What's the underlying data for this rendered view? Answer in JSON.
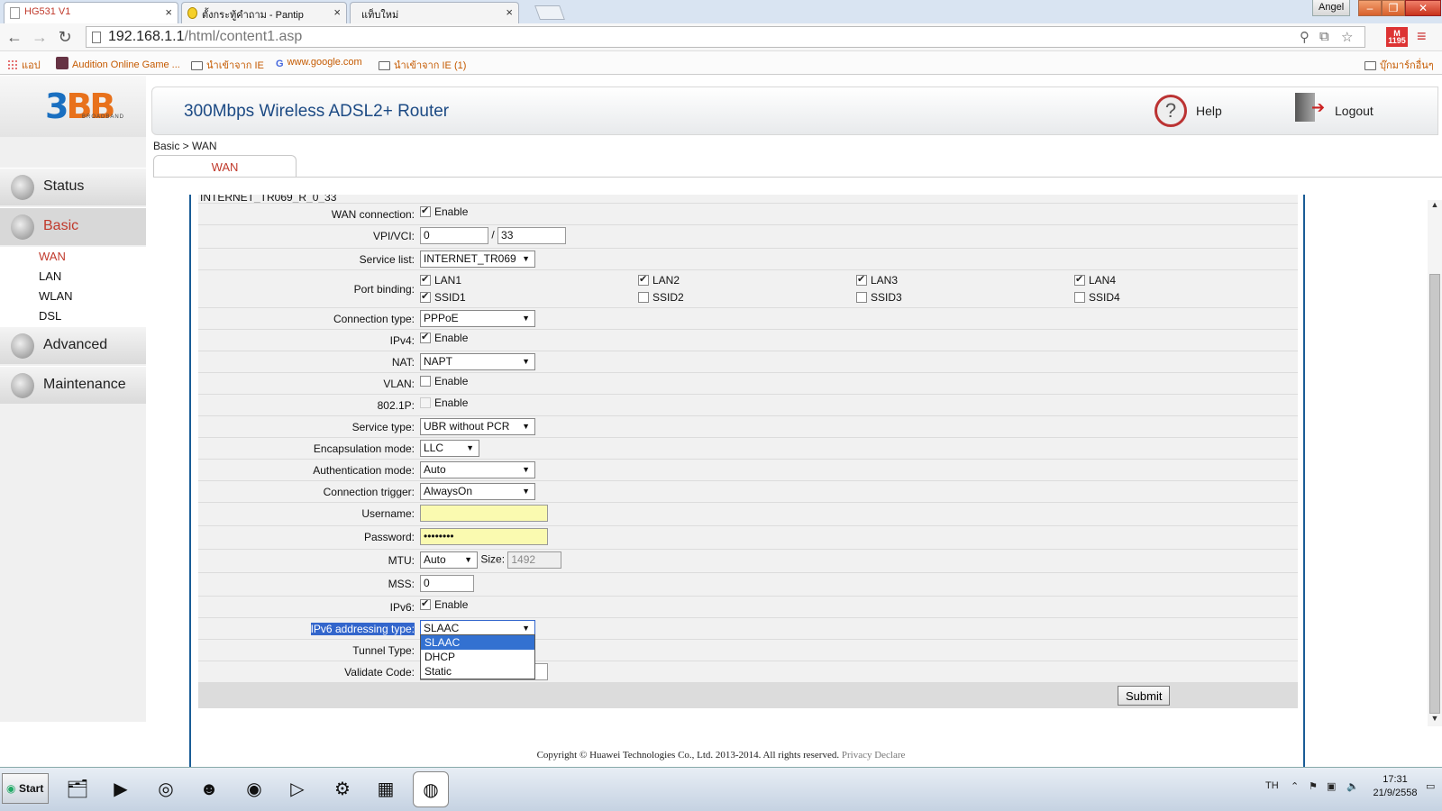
{
  "browser": {
    "tabs": [
      {
        "title": "HG531 V1",
        "active": true
      },
      {
        "title": "ตั้งกระทู้คำถาม - Pantip",
        "active": false
      },
      {
        "title": "แท็บใหม่",
        "active": false
      }
    ],
    "tab_close": "×",
    "profile_name": "Angel",
    "window_buttons": {
      "minimize": "–",
      "maximize": "❐",
      "close": "✕"
    },
    "url_host": "192.168.1.1",
    "url_path": "/html/content1.asp",
    "nav": {
      "back": "←",
      "forward": "→",
      "reload": "↻"
    },
    "gmail_badge": "1195",
    "gmail_letter": "M",
    "menu_icon": "≡",
    "bookmarks": [
      "แอป",
      "Audition Online Game ...",
      "นำเข้าจาก IE",
      "www.google.com",
      "นำเข้าจาก IE (1)"
    ],
    "bookmarks_right": "บุ๊กมาร์กอื่นๆ"
  },
  "router": {
    "title": "300Mbps Wireless ADSL2+ Router",
    "logo_main": "3",
    "logo_bb": "BB",
    "logo_sub": "BROADBAND",
    "help": "Help",
    "logout": "Logout",
    "help_glyph": "?",
    "logout_glyph": "➔",
    "breadcrumb": "Basic > WAN",
    "active_tab": "WAN",
    "nav": {
      "status": "Status",
      "basic": "Basic",
      "basic_sub": [
        "WAN",
        "LAN",
        "WLAN",
        "DSL"
      ],
      "advanced": "Advanced",
      "maintenance": "Maintenance"
    }
  },
  "form": {
    "connection_name": "INTERNET_TR069_R_0_33",
    "enable": "Enable",
    "labels": {
      "wan_connection": "WAN connection:",
      "vpi_vci": "VPI/VCI:",
      "service_list": "Service list:",
      "port_binding": "Port binding:",
      "connection_type": "Connection type:",
      "ipv4": "IPv4:",
      "nat": "NAT:",
      "vlan": "VLAN:",
      "p8021": "802.1P:",
      "service_type": "Service type:",
      "encapsulation": "Encapsulation mode:",
      "auth_mode": "Authentication mode:",
      "conn_trigger": "Connection trigger:",
      "username": "Username:",
      "password": "Password:",
      "mtu": "MTU:",
      "size": "Size:",
      "mss": "MSS:",
      "ipv6": "IPv6:",
      "ipv6_addressing": "IPv6 addressing type:",
      "tunnel_type": "Tunnel Type:",
      "validate_code": "Validate Code:"
    },
    "vpi": "0",
    "vci_sep": "/",
    "vci": "33",
    "service_list": "INTERNET_TR069",
    "ports": [
      {
        "name": "LAN1",
        "checked": true
      },
      {
        "name": "LAN2",
        "checked": true
      },
      {
        "name": "LAN3",
        "checked": true
      },
      {
        "name": "LAN4",
        "checked": true
      },
      {
        "name": "SSID1",
        "checked": true
      },
      {
        "name": "SSID2",
        "checked": false
      },
      {
        "name": "SSID3",
        "checked": false
      },
      {
        "name": "SSID4",
        "checked": false
      }
    ],
    "connection_type": "PPPoE",
    "nat": "NAPT",
    "service_type": "UBR without PCR",
    "encapsulation": "LLC",
    "auth_mode": "Auto",
    "conn_trigger": "AlwaysOn",
    "password_mask": "••••••••",
    "mtu": "Auto",
    "size": "1492",
    "mss": "0",
    "ipv6_addressing": "SLAAC",
    "ipv6_options": [
      "SLAAC",
      "DHCP",
      "Static"
    ],
    "submit": "Submit"
  },
  "footer": {
    "copyright": "Copyright © Huawei Technologies Co., Ltd. 2013-2014. All rights reserved.",
    "privacy": "Privacy Declare"
  },
  "taskbar": {
    "start": "Start",
    "lang": "TH",
    "time": "17:31",
    "date": "21/9/2558"
  }
}
